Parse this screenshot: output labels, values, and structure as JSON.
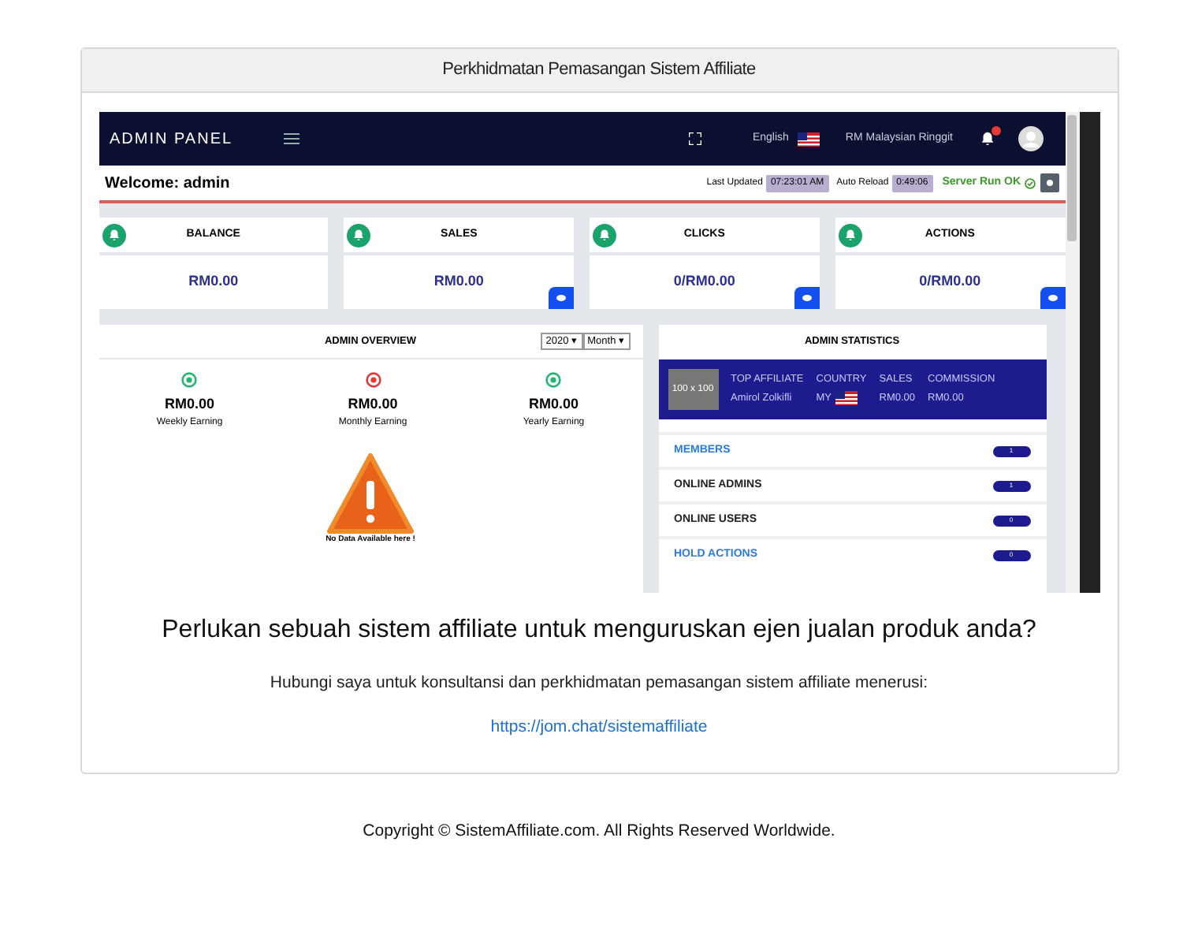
{
  "card": {
    "title": "Perkhidmatan Pemasangan Sistem Affiliate"
  },
  "screenshot": {
    "navbar": {
      "brand": "ADMIN PANEL",
      "language": "English",
      "currency": "RM Malaysian Ringgit"
    },
    "welcome": "Welcome: admin",
    "last_updated_label": "Last Updated",
    "last_updated": "07:23:01 AM",
    "auto_reload_label": "Auto Reload",
    "auto_reload": "0:49:06",
    "server_status": "Server Run OK",
    "stat_cards": [
      {
        "title": "BALANCE",
        "value": "RM0.00",
        "view_button": false
      },
      {
        "title": "SALES",
        "value": "RM0.00",
        "view_button": true
      },
      {
        "title": "CLICKS",
        "value": "0/RM0.00",
        "view_button": true
      },
      {
        "title": "ACTIONS",
        "value": "0/RM0.00",
        "view_button": true
      }
    ],
    "overview": {
      "title": "ADMIN OVERVIEW",
      "year": "2020 ▾",
      "period": "Month ▾",
      "earnings": [
        {
          "value": "RM0.00",
          "label": "Weekly Earning",
          "kind": "up"
        },
        {
          "value": "RM0.00",
          "label": "Monthly Earning",
          "kind": "down"
        },
        {
          "value": "RM0.00",
          "label": "Yearly Earning",
          "kind": "up"
        }
      ],
      "empty_message": "No Data Available here !"
    },
    "statistics": {
      "title": "ADMIN STATISTICS",
      "avatar_text": "100 x 100",
      "columns": [
        {
          "heading": "TOP AFFILIATE",
          "value": "Amirol Zolkifli",
          "kind": "text"
        },
        {
          "heading": "COUNTRY",
          "value": "MY",
          "kind": "country"
        },
        {
          "heading": "SALES",
          "value": "RM0.00",
          "kind": "text"
        },
        {
          "heading": "COMMISSION",
          "value": "RM0.00",
          "kind": "text"
        }
      ],
      "rows": [
        {
          "label": "MEMBERS",
          "count": "1",
          "link": true
        },
        {
          "label": "ONLINE ADMINS",
          "count": "1",
          "link": false
        },
        {
          "label": "ONLINE USERS",
          "count": "0",
          "link": false
        },
        {
          "label": "HOLD ACTIONS",
          "count": "0",
          "link": true
        }
      ]
    }
  },
  "headline": "Perlukan sebuah sistem affiliate untuk menguruskan ejen jualan produk anda?",
  "subtitle": "Hubungi saya untuk konsultansi dan perkhidmatan pemasangan sistem affiliate menerusi:",
  "link": "https://jom.chat/sistemaffiliate",
  "footer": "Copyright © SistemAffiliate.com. All Rights Reserved Worldwide."
}
